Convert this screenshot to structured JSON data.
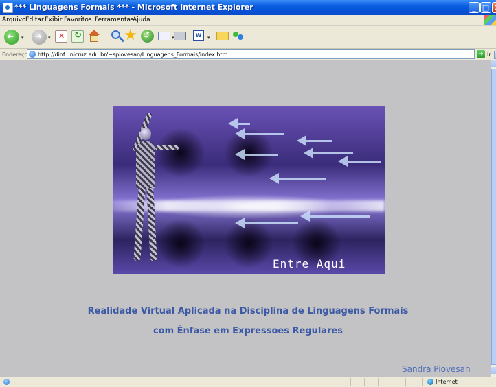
{
  "window": {
    "title": "*** Linguagens Formais *** - Microsoft Internet Explorer",
    "controls": {
      "minimize": "_",
      "maximize": "□",
      "close": "✕"
    }
  },
  "menu": {
    "items": [
      "Arquivo",
      "Editar",
      "Exibir",
      "Favoritos",
      "Ferramentas",
      "Ajuda"
    ]
  },
  "toolbar": {
    "icons": [
      "back-icon",
      "forward-icon",
      "stop-icon",
      "refresh-icon",
      "home-icon",
      "search-icon",
      "favorites-icon",
      "history-icon",
      "mail-icon",
      "print-icon",
      "edit-word-icon",
      "folder-icon",
      "messenger-icon"
    ]
  },
  "address": {
    "label": "Endereço",
    "url": "http://dinf.unicruz.edu.br/~spiovesan/Linguagens_Formais/index.htm",
    "go_label": "Ir"
  },
  "page": {
    "banner_link": "Entre Aqui",
    "heading_line1": "Realidade Virtual Aplicada na Disciplina de Linguagens Formais",
    "heading_line2": "com Ênfase em Expressões Regulares",
    "author": "Sandra Piovesan"
  },
  "status": {
    "zone": "Internet"
  },
  "colors": {
    "page_background": "#c3c3c6",
    "heading_text": "#3b59a4",
    "link_text": "#4e6fb8"
  }
}
